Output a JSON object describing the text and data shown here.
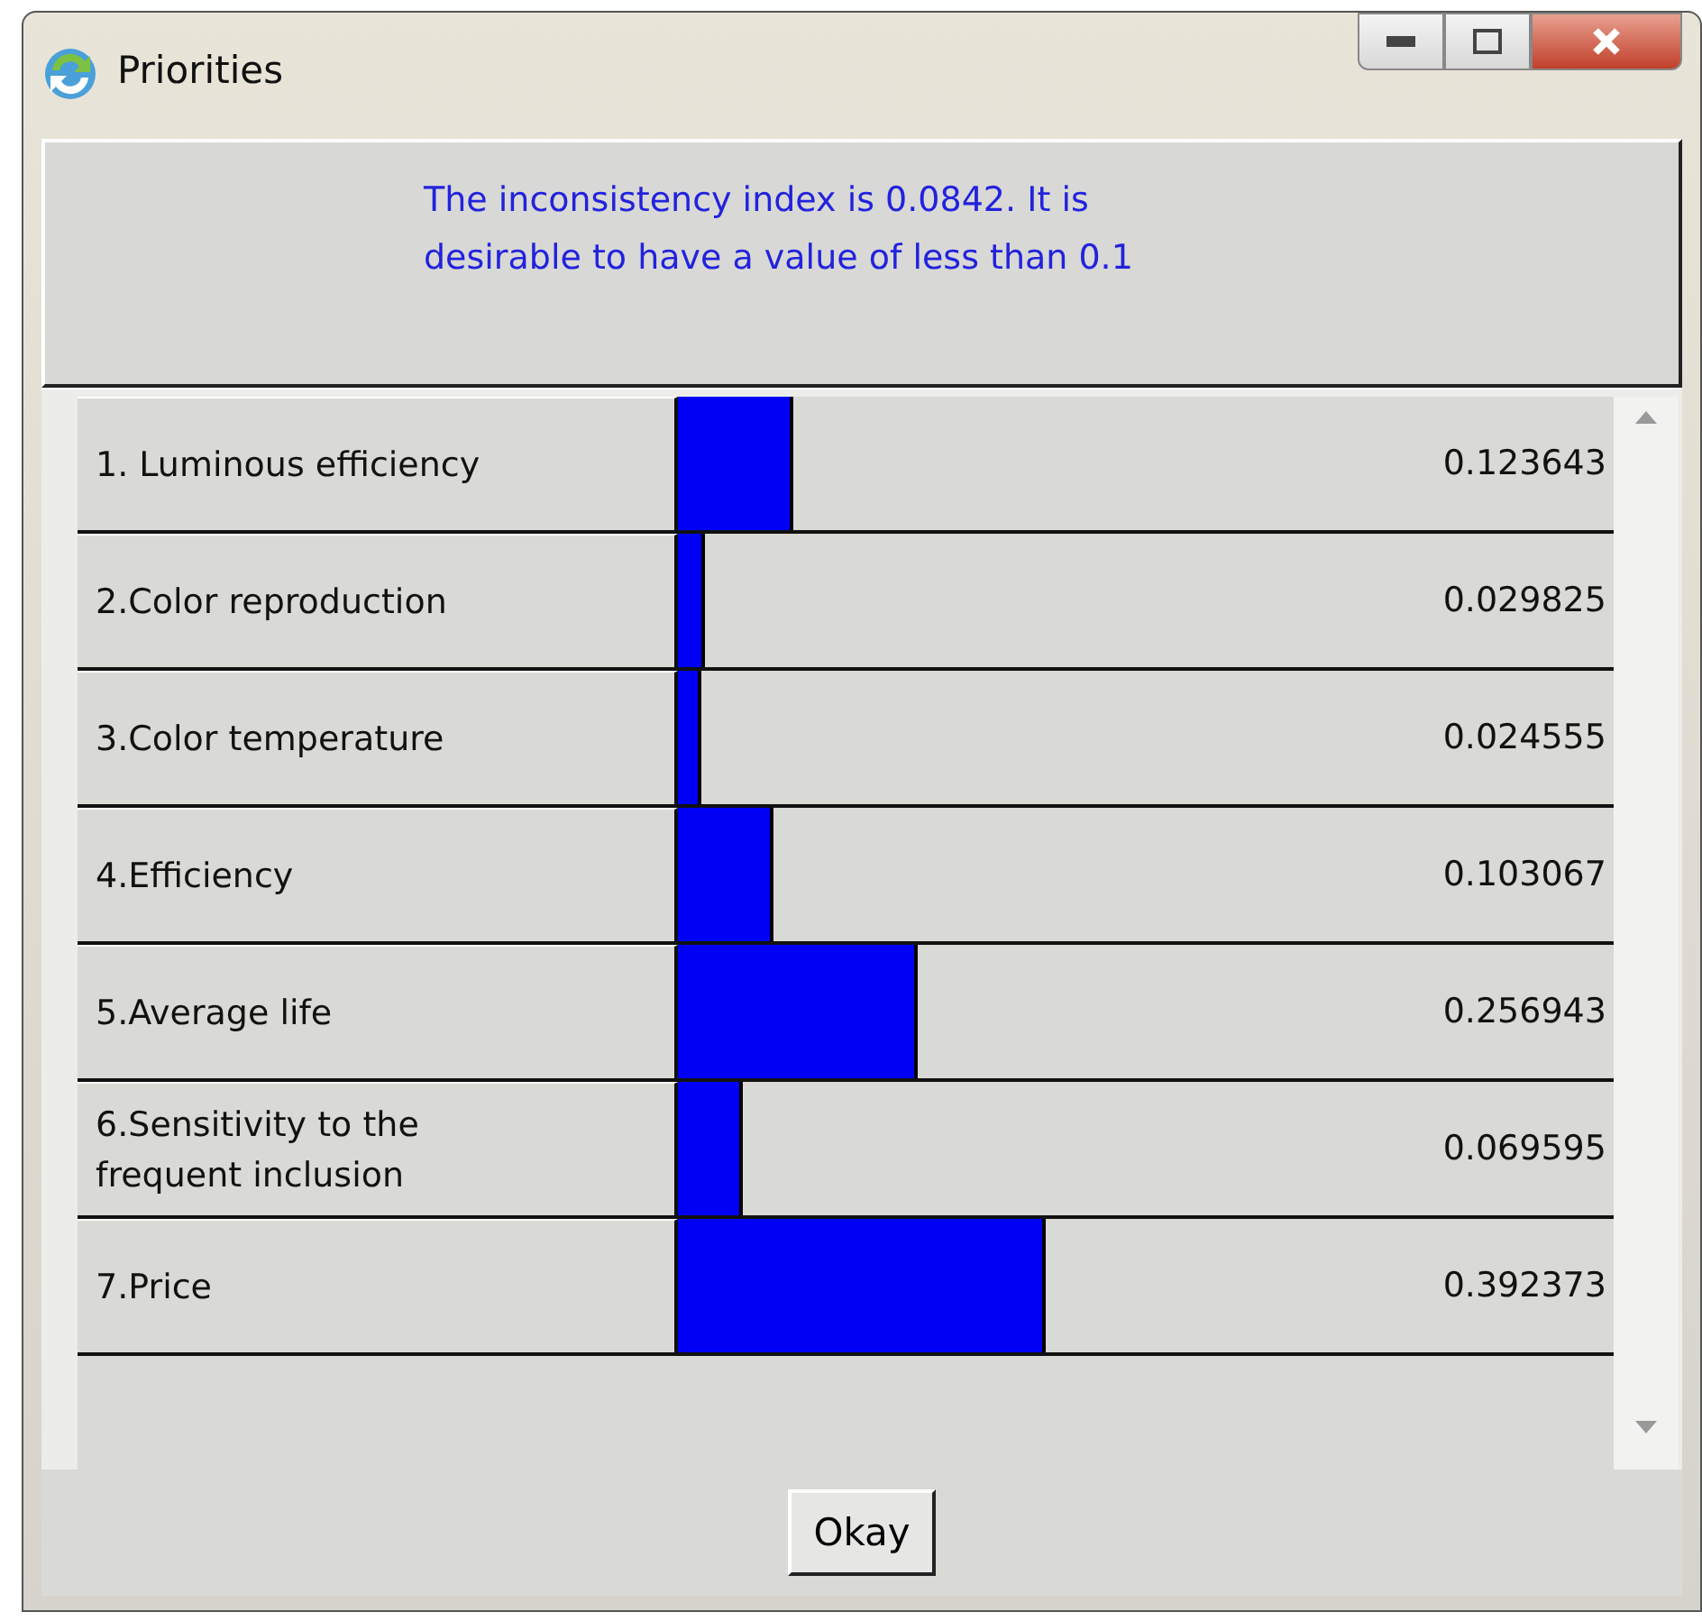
{
  "window": {
    "title": "Priorities"
  },
  "message": "The inconsistency index is 0.0842.  It is desirable to have a value of less than 0.1",
  "priorities": [
    {
      "label": "1. Luminous efficiency",
      "reading": "0.123643"
    },
    {
      "label": "2.Color reproduction",
      "reading": "0.029825"
    },
    {
      "label": "3.Color temperature",
      "reading": "0.024555"
    },
    {
      "label": "4.Efficiency",
      "reading": "0.103067"
    },
    {
      "label": "5.Average life",
      "reading": "0.256943"
    },
    {
      "label": "6.Sensitivity to the frequent inclusion",
      "reading": "0.069595"
    },
    {
      "label": "7.Price",
      "reading": "0.392373"
    }
  ],
  "buttons": [
    "Okay"
  ]
}
